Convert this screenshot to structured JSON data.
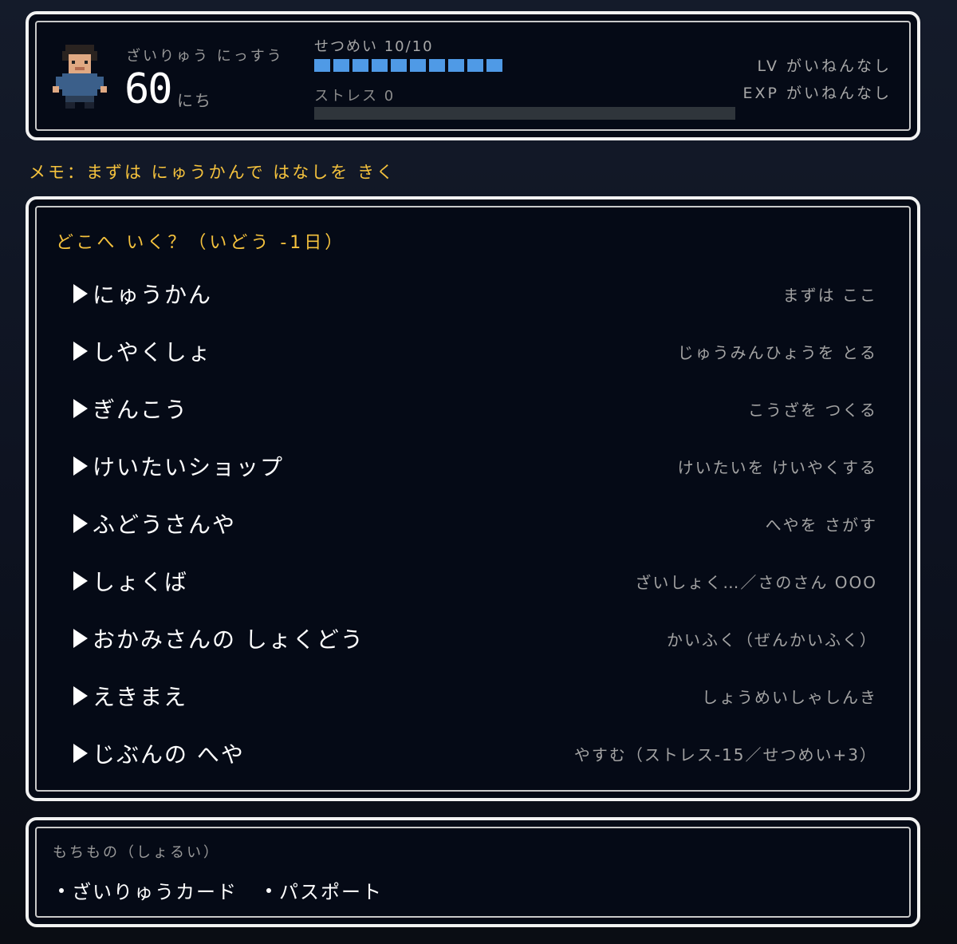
{
  "status": {
    "days_label": "ざいりゅう にっすう",
    "days_value": "60",
    "days_unit": "にち",
    "energy_label": "せつめい 10/10",
    "energy_current": 10,
    "energy_max": 10,
    "stress_label": "ストレス 0",
    "stress_value": 0,
    "lv_text": "LV がいねんなし",
    "exp_text": "EXP がいねんなし"
  },
  "memo": "メモ：まずは にゅうかんで はなしを きく",
  "menu": {
    "title": "どこへ いく？（いどう -1日）",
    "items": [
      {
        "label": "にゅうかん",
        "desc": "まずは ここ"
      },
      {
        "label": "しやくしょ",
        "desc": "じゅうみんひょうを とる"
      },
      {
        "label": "ぎんこう",
        "desc": "こうざを つくる"
      },
      {
        "label": "けいたいショップ",
        "desc": "けいたいを けいやくする"
      },
      {
        "label": "ふどうさんや",
        "desc": "へやを さがす"
      },
      {
        "label": "しょくば",
        "desc": "ざいしょく…／さのさん OOO"
      },
      {
        "label": "おかみさんの しょくどう",
        "desc": "かいふく（ぜんかいふく）"
      },
      {
        "label": "えきまえ",
        "desc": "しょうめいしゃしんき"
      },
      {
        "label": "じぶんの へや",
        "desc": "やすむ（ストレス-15／せつめい+3）"
      }
    ]
  },
  "inventory": {
    "title": "もちもの（しょるい）",
    "items": [
      "ざいりゅうカード",
      "パスポート"
    ]
  },
  "colors": {
    "accent": "#f5c23d",
    "energy": "#4f9ae6",
    "window_bg": "#050a16",
    "border": "#f2f2f2"
  }
}
